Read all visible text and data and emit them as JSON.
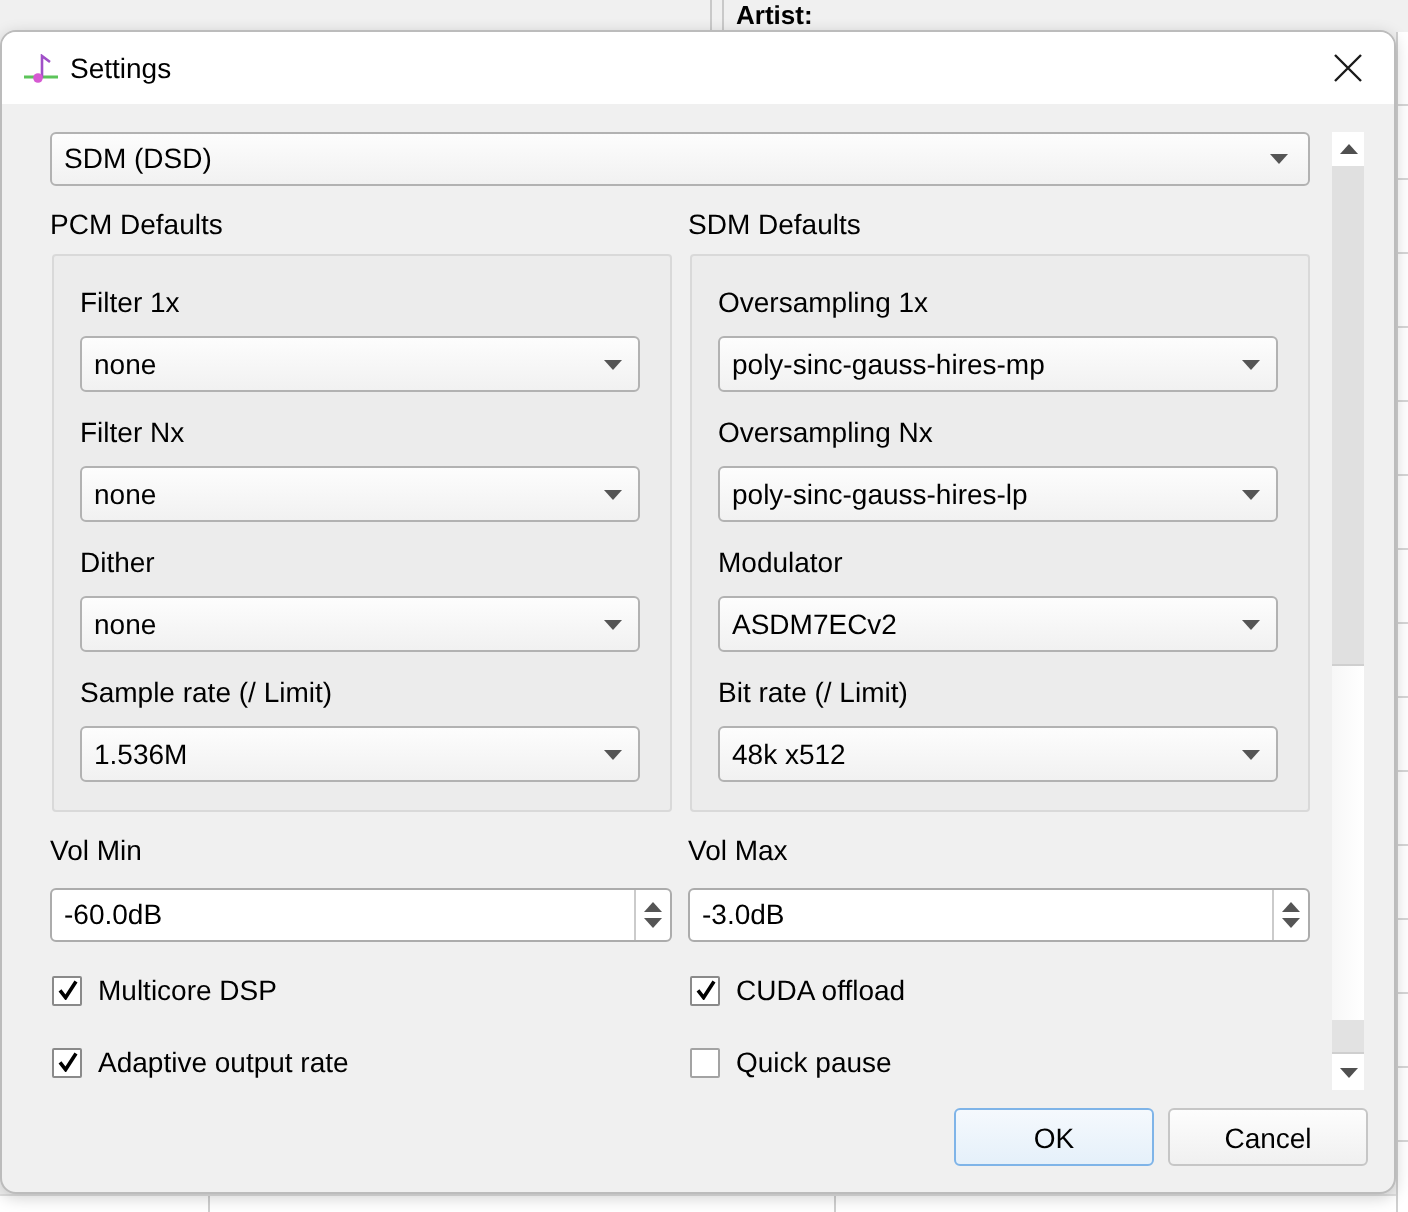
{
  "background_window": {
    "label": "Artist:"
  },
  "window": {
    "title": "Settings"
  },
  "mode_select": {
    "value": "SDM (DSD)"
  },
  "groups": [
    {
      "title": "PCM Defaults",
      "fields": [
        {
          "label": "Filter 1x",
          "value": "none"
        },
        {
          "label": "Filter Nx",
          "value": "none"
        },
        {
          "label": "Dither",
          "value": "none"
        },
        {
          "label": "Sample rate (/ Limit)",
          "value": "1.536M"
        }
      ]
    },
    {
      "title": "SDM Defaults",
      "fields": [
        {
          "label": "Oversampling 1x",
          "value": "poly-sinc-gauss-hires-mp"
        },
        {
          "label": "Oversampling Nx",
          "value": "poly-sinc-gauss-hires-lp"
        },
        {
          "label": "Modulator",
          "value": "ASDM7ECv2"
        },
        {
          "label": "Bit rate (/ Limit)",
          "value": "48k x512"
        }
      ]
    }
  ],
  "volume": [
    {
      "label": "Vol Min",
      "value": "-60.0dB"
    },
    {
      "label": "Vol Max",
      "value": "-3.0dB"
    }
  ],
  "options": [
    {
      "label": "Multicore DSP",
      "checked": true
    },
    {
      "label": "CUDA offload",
      "checked": true
    },
    {
      "label": "Adaptive output rate",
      "checked": true
    },
    {
      "label": "Quick pause",
      "checked": false
    }
  ],
  "buttons": [
    {
      "label": "OK",
      "default": true
    },
    {
      "label": "Cancel",
      "default": false
    }
  ]
}
